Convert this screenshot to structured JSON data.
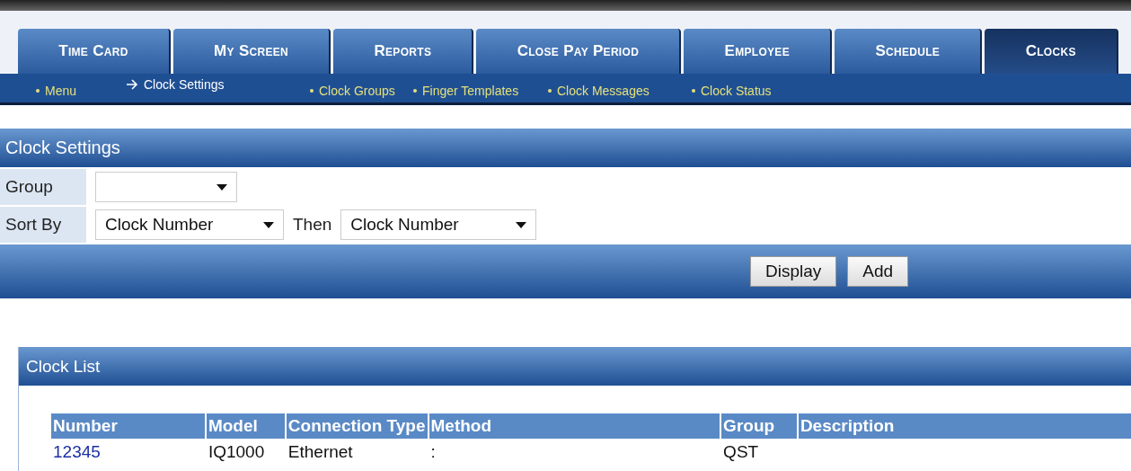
{
  "tabs": [
    {
      "label": "Time Card",
      "selected": false
    },
    {
      "label": "My Screen",
      "selected": false
    },
    {
      "label": "Reports",
      "selected": false
    },
    {
      "label": "Close Pay Period",
      "selected": false
    },
    {
      "label": "Employee",
      "selected": false
    },
    {
      "label": "Schedule",
      "selected": false
    },
    {
      "label": "Clocks",
      "selected": true
    }
  ],
  "subnav": [
    {
      "label": "Menu",
      "selected": false
    },
    {
      "label": "Clock Settings",
      "selected": true
    },
    {
      "label": "Clock Groups",
      "selected": false
    },
    {
      "label": "Finger Templates",
      "selected": false
    },
    {
      "label": "Clock Messages",
      "selected": false
    },
    {
      "label": "Clock Status",
      "selected": false
    }
  ],
  "settings": {
    "title": "Clock Settings",
    "group_label": "Group",
    "sort_label": "Sort By",
    "sort_value": "Clock Number",
    "then_label": "Then",
    "then_value": "Clock Number"
  },
  "buttons": [
    "Display",
    "Add"
  ],
  "clock_list": {
    "title": "Clock List",
    "columns": [
      "Number",
      "Model",
      "Connection Type",
      "Method",
      "Group",
      "Description"
    ],
    "rows": [
      {
        "number": "12345",
        "model": "IQ1000",
        "connection_type": "Ethernet",
        "method": ":",
        "group": "QST"
      }
    ]
  }
}
